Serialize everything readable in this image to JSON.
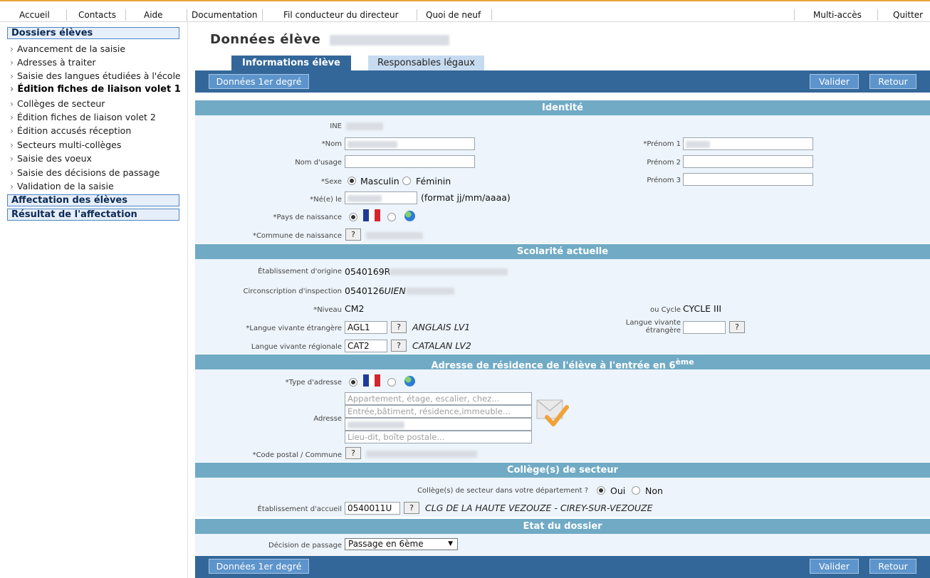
{
  "menu": {
    "left": [
      "Accueil",
      "Contacts",
      "Aide",
      "Documentation",
      "Fil conducteur du directeur",
      "Quoi de neuf"
    ],
    "right": [
      "Multi-accès",
      "Quitter"
    ]
  },
  "sidebar": {
    "section1": "Dossiers élèves",
    "items": [
      "Avancement de la saisie",
      "Adresses à traiter",
      "Saisie des langues étudiées à l'école",
      "Édition fiches de liaison volet 1",
      "Collèges de secteur",
      "Édition fiches de liaison volet 2",
      "Édition accusés réception",
      "Secteurs multi-collèges",
      "Saisie des voeux",
      "Saisie des décisions de passage",
      "Validation de la saisie"
    ],
    "section2": "Affectation des élèves",
    "section3": "Résultat de l'affectation"
  },
  "page": {
    "title": "Données élève",
    "tabs": [
      "Informations élève",
      "Responsables légaux"
    ]
  },
  "toolbar": {
    "primary_degree": "Données 1er degré",
    "validate": "Valider",
    "back": "Retour"
  },
  "identity": {
    "header": "Identité",
    "ine_label": "INE",
    "nom_label": "*Nom",
    "nom_usage_label": "Nom d'usage",
    "sexe_label": "*Sexe",
    "masculin": "Masculin",
    "feminin": "Féminin",
    "ne_le_label": "*Né(e) le",
    "date_format": "(format jj/mm/aaaa)",
    "pays_label": "*Pays de naissance",
    "commune_label": "*Commune de naissance",
    "prenom1_label": "*Prénom 1",
    "prenom2_label": "Prénom 2",
    "prenom3_label": "Prénom 3",
    "help": "?"
  },
  "schooling": {
    "header": "Scolarité actuelle",
    "origine_label": "Établissement d'origine",
    "origine_value": "0540169R",
    "circo_label": "Circonscription d'inspection",
    "circo_value_a": "0540126",
    "circo_value_b": "UIEN",
    "niveau_label": "*Niveau",
    "niveau_value": "CM2",
    "cycle_label": "ou Cycle",
    "cycle_value": "CYCLE III",
    "lve_label": "*Langue vivante étrangère",
    "lve_code": "AGL1",
    "lve_name": "ANGLAIS LV1",
    "lve2_label_a": "Langue vivante",
    "lve2_label_b": "étrangère",
    "lvr_label": "Langue vivante régionale",
    "lvr_code": "CAT2",
    "lvr_name": "CATALAN LV2"
  },
  "address": {
    "header": "Adresse de résidence de l'élève à l'entrée en 6",
    "header_sup": "ème",
    "type_label": "*Type d'adresse",
    "adresse_label": "Adresse",
    "line1_placeholder": "Appartement, étage, escalier, chez...",
    "line2_placeholder": "Entrée,bâtiment, résidence,immeuble...",
    "line4_placeholder": "Lieu-dit, boîte postale...",
    "cp_label": "*Code postal / Commune"
  },
  "college": {
    "header": "Collège(s) de secteur",
    "question": "Collège(s) de secteur dans votre département ?",
    "oui": "Oui",
    "non": "Non",
    "accueil_label": "Établissement d'accueil",
    "accueil_code": "0540011U",
    "accueil_name": "CLG DE LA HAUTE VEZOUZE - CIREY-SUR-VEZOUZE"
  },
  "status": {
    "header": "Etat du dossier",
    "decision_label": "Décision de passage",
    "decision_value": "Passage en 6ème"
  },
  "colors": {
    "nav_blue": "#336799",
    "section_header": "#70aac5",
    "section_body": "#edf4fb",
    "accent_orange": "#e8a33a"
  }
}
